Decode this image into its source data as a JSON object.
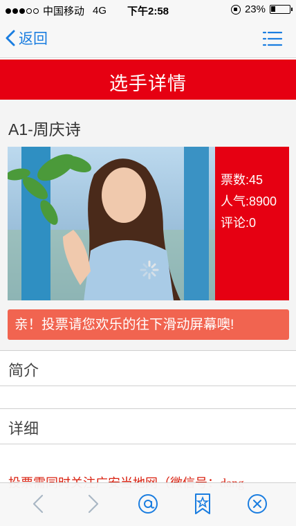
{
  "status_bar": {
    "carrier": "中国移动",
    "network": "4G",
    "time": "下午2:58",
    "battery": "23%"
  },
  "nav": {
    "back_label": "返回",
    "menu_icon": "list-menu-icon"
  },
  "header": {
    "title": "选手详情"
  },
  "player": {
    "title": "A1-周庆诗",
    "photo_icon": "player-photo",
    "stats": {
      "votes": "票数:45",
      "popularity": "人气:8900",
      "comments": "评论:0"
    }
  },
  "banner": {
    "text": "亲！投票请您欢乐的往下滑动屏幕噢!"
  },
  "sections": {
    "intro_label": "简介",
    "detail_label": "详细",
    "detail_text": "投票需同时关注广安当地网（微信号：dang"
  },
  "colors": {
    "accent_red": "#e60012",
    "banner_coral": "#f16450",
    "link_blue": "#1a7de0"
  },
  "toolbar": {
    "icons": [
      "back-arrow-icon",
      "forward-arrow-icon",
      "at-icon",
      "bookmark-star-icon",
      "close-circle-icon"
    ]
  }
}
